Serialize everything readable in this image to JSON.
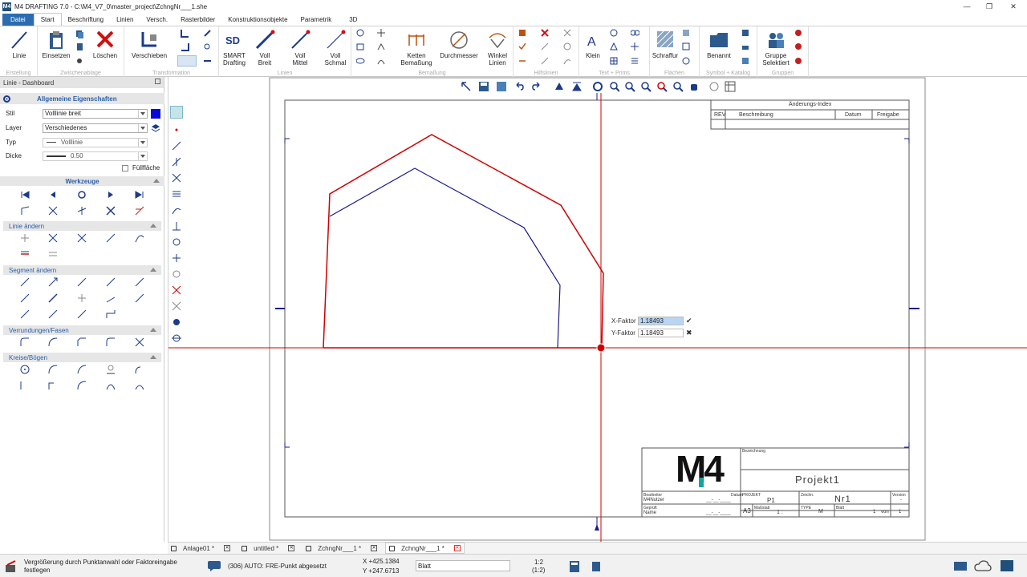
{
  "window": {
    "title": "M4 DRAFTING 7.0  -  C:\\M4_V7_0\\master_project\\ZchngNr___1.she",
    "logo": "M4"
  },
  "menu": {
    "tabs": [
      "Datei",
      "Start",
      "Beschriftung",
      "Linien",
      "Versch.",
      "Rasterbilder",
      "Konstruktionsobjekte",
      "Parametrik",
      "3D"
    ]
  },
  "ribbon": {
    "groups": {
      "erstellung": "Erstellung",
      "zwischenablage": "Zwischenablage",
      "transformation": "Transformation",
      "linien": "Linien",
      "bemassung": "Bemaßung",
      "hilfslinien": "Hilfslinien",
      "text_prims": "Text + Prims",
      "flaechen": "Flächen",
      "symbol_katalog": "Symbol + Katalog",
      "gruppen": "Gruppen"
    },
    "buttons": {
      "linie": "Linie",
      "einsetzen": "Einsetzen",
      "loeschen": "Löschen",
      "verschieben": "Verschieben",
      "smart1": "SMART",
      "smart2": "Drafting",
      "vb1": "Voll",
      "vb2": "Breit",
      "vm1": "Voll",
      "vm2": "Mittel",
      "vs1": "Voll",
      "vs2": "Schmal",
      "kb1": "Ketten",
      "kb2": "Bemaßung",
      "durch": "Durchmesser",
      "wl1": "Winkel",
      "wl2": "Linien",
      "klein": "Klein",
      "schraffur": "Schraffur",
      "benannt": "Benannt",
      "gs1": "Gruppe",
      "gs2": "Selektiert"
    }
  },
  "panel": {
    "title": "Linie - Dashboard",
    "props_header": "Allgemeine Eigenschaften",
    "stil_label": "Stil",
    "stil_value": "Volllinie breit",
    "stil_color": "#0a0ad8",
    "layer_label": "Layer",
    "layer_value": "Verschiedenes",
    "typ_label": "Typ",
    "typ_value": "Volllinie",
    "dicke_label": "Dicke",
    "dicke_value": "0.50",
    "fill_label": "Füllfläche",
    "werkzeuge": "Werkzeuge",
    "linie_aendern": "Linie ändern",
    "segment_aendern": "Segment ändern",
    "verrundungen": "Verrundungen/Fasen",
    "kreise": "Kreise/Bögen"
  },
  "drawing": {
    "revision_block": {
      "title": "Änderungs-Index",
      "col_rev": "REV",
      "col_beschreibung": "Beschreibung",
      "col_datum": "Datum",
      "col_freigabe": "Freigabe"
    },
    "title_block": {
      "logo": "M4",
      "bezeichnung_lbl": "Bezeichnung",
      "projekt": "Projekt1",
      "bearbeiter_lbl": "Bearbeiter",
      "datum_lbl": "Datum",
      "bearbeiter_name": "M4Nutzer",
      "date_placeholder": "__-__-____",
      "projekt_lbl": "PROJEKT",
      "projekt_value": "P1",
      "zeichnung_lbl": "Zeichn.",
      "zeichnung_value": "Nr1",
      "version_lbl": "Version",
      "version_value": "-",
      "geprueft_lbl": "Geprüft",
      "geprueft_value": "Name",
      "format": "A3",
      "massstab_lbl": "Maßstab",
      "massstab": "1 :",
      "typ_lbl": "TYPE",
      "typ_value": "M",
      "blatt_lbl": "Blatt",
      "blatt_value": "1",
      "von_lbl": "von",
      "von_value": "1"
    },
    "scale_input": {
      "x_label": "X-Faktor",
      "x_value": "1.18493",
      "y_label": "Y-Faktor",
      "y_value": "1.18493"
    },
    "shape_colors": {
      "outer": "#d00000",
      "inner": "#1a1a8c",
      "crosshair": "#d00000"
    }
  },
  "doc_tabs": [
    {
      "label": "Anlage01 *",
      "active": false
    },
    {
      "label": "untitled *",
      "active": false
    },
    {
      "label": "ZchngNr___1 *",
      "active": false
    },
    {
      "label": "ZchngNr___1 *",
      "active": true
    }
  ],
  "status": {
    "message1": "Vergrößerung durch Punktanwahl oder Faktoreingabe",
    "message2": "festlegen",
    "prompt": "(306) AUTO: FRE-Punkt abgesetzt",
    "x_coord": "X +425.1384",
    "y_coord": "Y +247.6713",
    "sheet": "Blatt",
    "scale1": "1:2",
    "scale2": "(1:2)"
  }
}
